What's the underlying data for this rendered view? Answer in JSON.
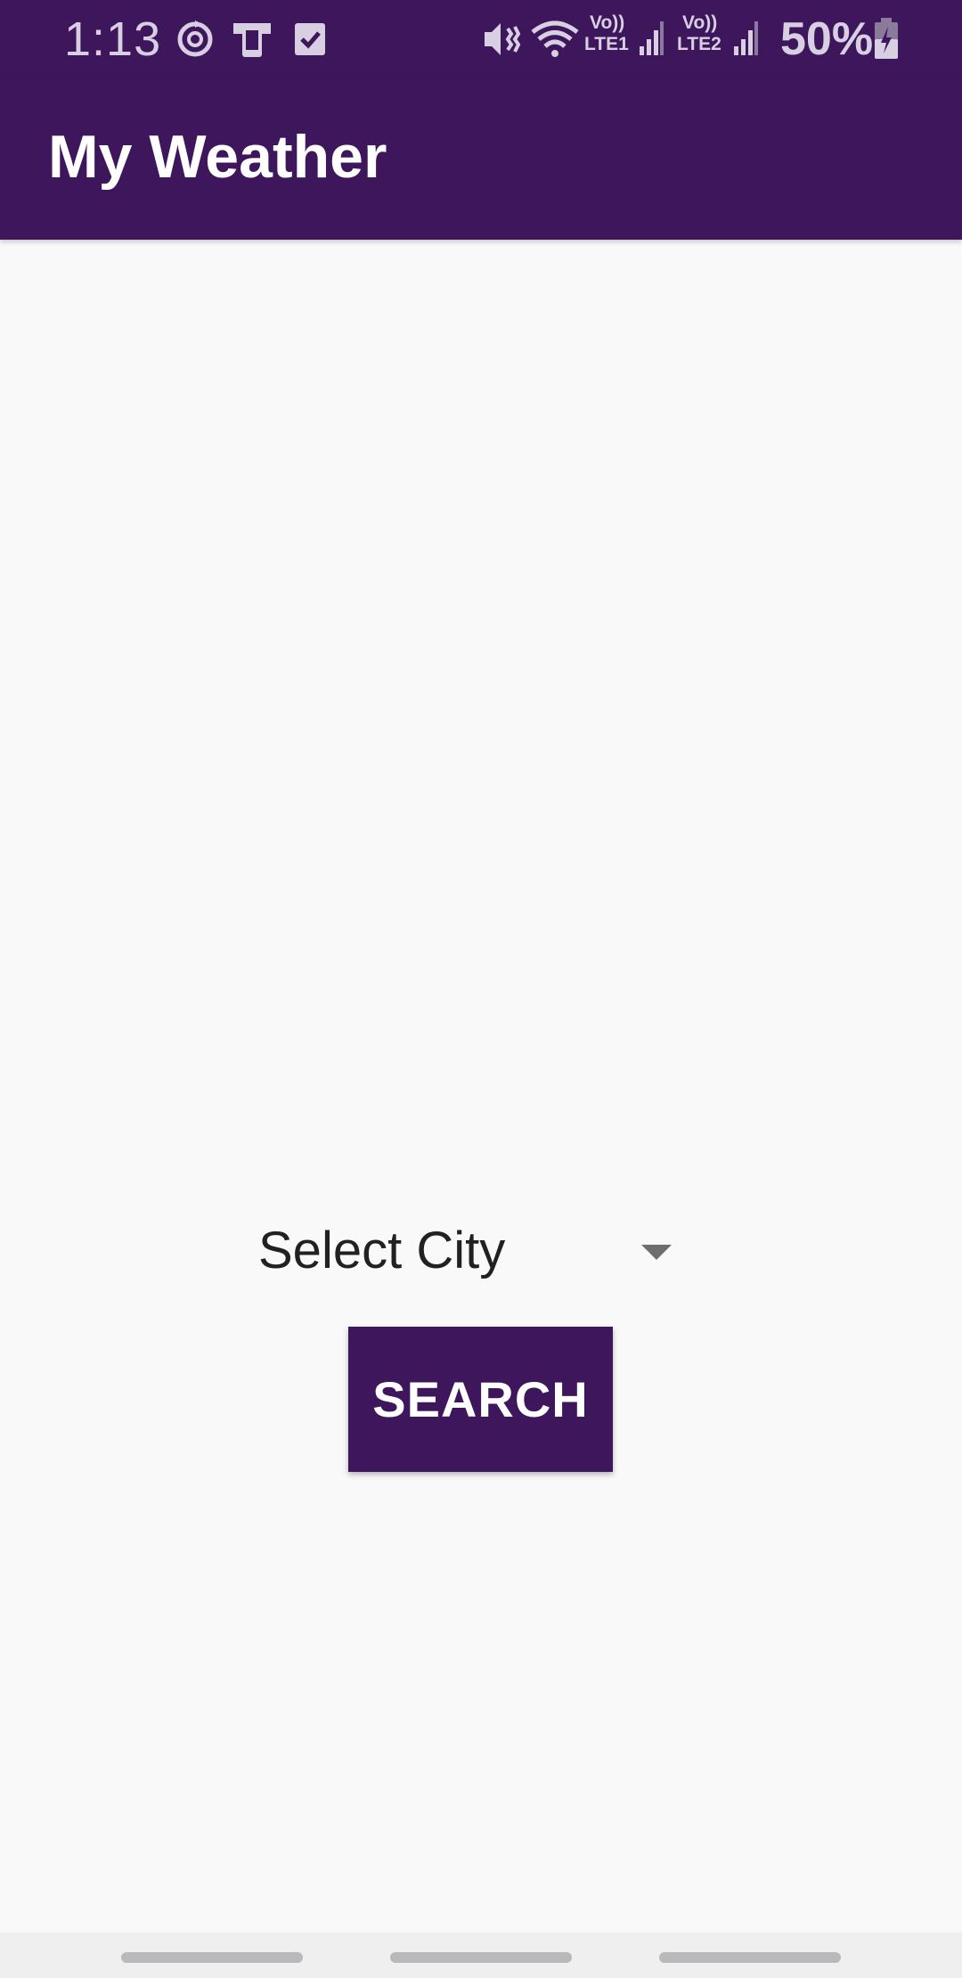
{
  "status_bar": {
    "time": "1:13",
    "sim1_label_top": "Vo))",
    "sim1_label_bottom": "LTE1",
    "sim2_label_top": "Vo))",
    "sim2_label_bottom": "LTE2",
    "battery_percent": "50%",
    "icons": [
      "sync-icon",
      "phone-device-icon",
      "checkbox-icon",
      "mute-vibrate-icon",
      "wifi-icon",
      "signal-icon",
      "battery-charging-icon"
    ]
  },
  "app_bar": {
    "title": "My Weather"
  },
  "main": {
    "city_spinner_value": "Select City",
    "search_button_label": "SEARCH"
  },
  "colors": {
    "primary": "#3e165c",
    "background": "#f9f9fa",
    "text": "#212121"
  }
}
